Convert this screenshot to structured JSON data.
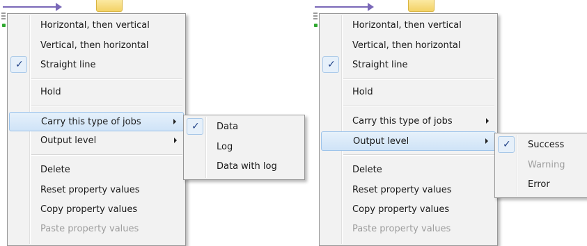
{
  "menu": {
    "items": [
      {
        "label": "Horizontal, then vertical"
      },
      {
        "label": "Vertical, then horizontal"
      },
      {
        "label": "Straight line",
        "checked": true
      },
      {
        "label": "Hold"
      },
      {
        "label": "Carry this type of jobs",
        "has_submenu": true
      },
      {
        "label": "Output level",
        "has_submenu": true
      },
      {
        "label": "Delete"
      },
      {
        "label": "Reset property values"
      },
      {
        "label": "Copy property values"
      },
      {
        "label": "Paste property values",
        "disabled": true
      }
    ]
  },
  "submenu_carry": {
    "items": [
      {
        "label": "Data",
        "checked": true
      },
      {
        "label": "Log"
      },
      {
        "label": "Data with log"
      }
    ]
  },
  "submenu_output": {
    "items": [
      {
        "label": "Success",
        "checked": true
      },
      {
        "label": "Warning",
        "disabled": true
      },
      {
        "label": "Error"
      }
    ]
  },
  "check_glyph": "✓",
  "colors": {
    "menu_bg": "#f2f2f2",
    "highlight": "#cfe3f7",
    "highlight_border": "#9cc3ea",
    "disabled_text": "#9d9d9d",
    "connector": "#7a68b8"
  }
}
